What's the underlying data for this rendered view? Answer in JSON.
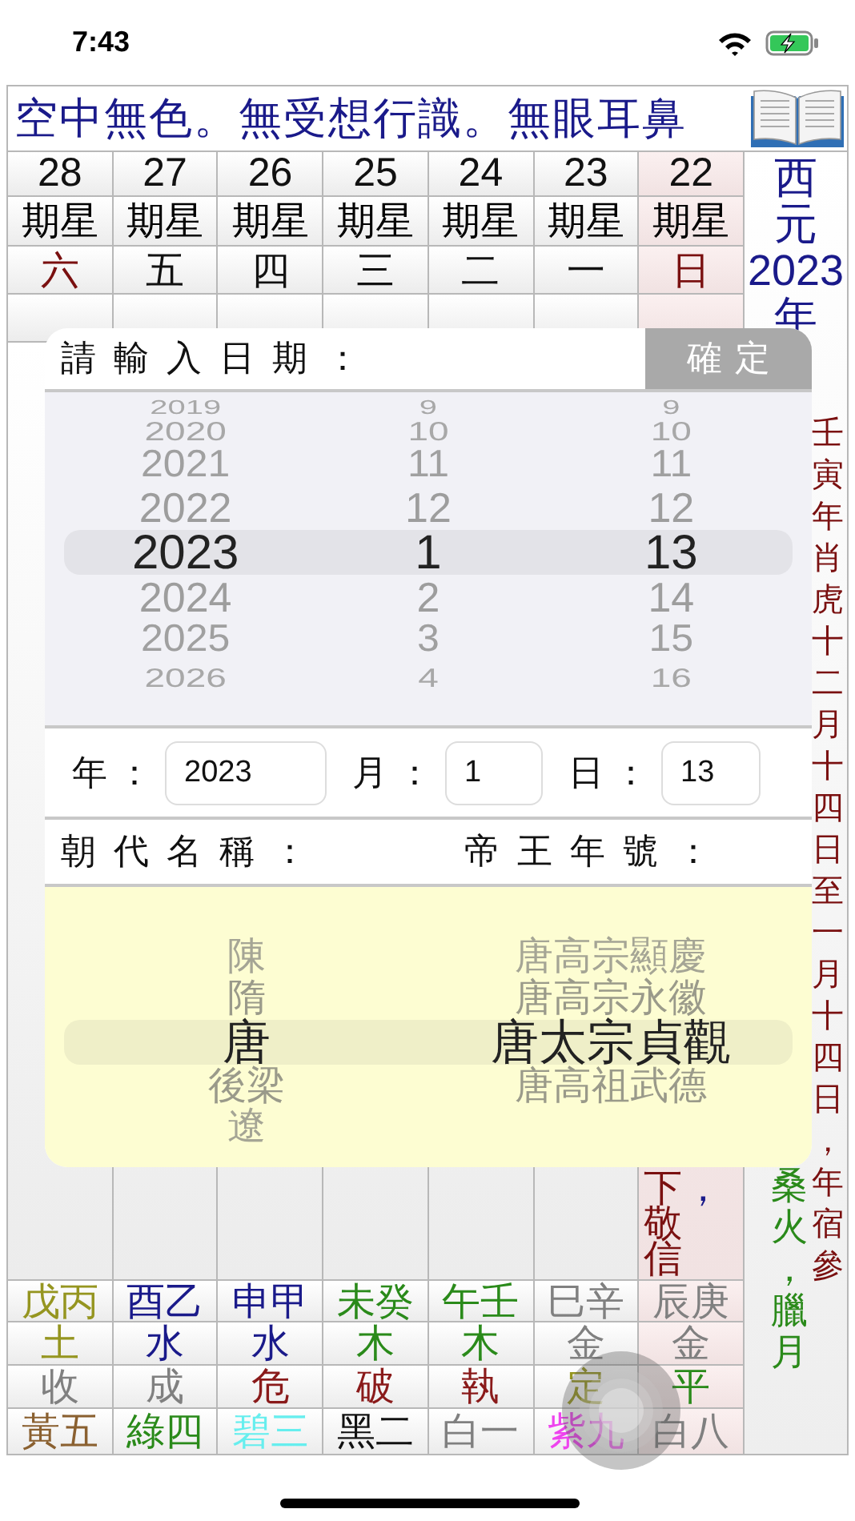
{
  "status_bar": {
    "time": "7:43"
  },
  "banner": {
    "text": "空中無色。無受想行識。無眼耳鼻"
  },
  "days": [
    {
      "date": "28",
      "week_label": "期星",
      "weekday": {
        "text": "六",
        "color": "#7a1010"
      },
      "ganzhi": {
        "text": "戊丙",
        "color": "#959520"
      },
      "element": {
        "text": "土",
        "color": "#959520"
      },
      "officer": {
        "text": "收",
        "color": "#808080"
      },
      "star": {
        "text": "黃五",
        "color": "#8a6030"
      },
      "selected": false
    },
    {
      "date": "27",
      "week_label": "期星",
      "weekday": {
        "text": "五",
        "color": "#111111"
      },
      "ganzhi": {
        "text": "酉乙",
        "color": "#1a1a8a"
      },
      "element": {
        "text": "水",
        "color": "#1a1a8a"
      },
      "officer": {
        "text": "成",
        "color": "#808080"
      },
      "star": {
        "text": "綠四",
        "color": "#2a8a1a"
      },
      "selected": false
    },
    {
      "date": "26",
      "week_label": "期星",
      "weekday": {
        "text": "四",
        "color": "#111111"
      },
      "ganzhi": {
        "text": "申甲",
        "color": "#1a1a8a"
      },
      "element": {
        "text": "水",
        "color": "#1a1a8a"
      },
      "officer": {
        "text": "危",
        "color": "#8a1a1a"
      },
      "star": {
        "text": "碧三",
        "color": "#66eeee"
      },
      "selected": false
    },
    {
      "date": "25",
      "week_label": "期星",
      "weekday": {
        "text": "三",
        "color": "#111111"
      },
      "ganzhi": {
        "text": "未癸",
        "color": "#2a8a1a"
      },
      "element": {
        "text": "木",
        "color": "#2a8a1a"
      },
      "officer": {
        "text": "破",
        "color": "#8a1a1a"
      },
      "star": {
        "text": "黑二",
        "color": "#111111"
      },
      "selected": false
    },
    {
      "date": "24",
      "week_label": "期星",
      "weekday": {
        "text": "二",
        "color": "#111111"
      },
      "ganzhi": {
        "text": "午壬",
        "color": "#2a8a1a"
      },
      "element": {
        "text": "木",
        "color": "#2a8a1a"
      },
      "officer": {
        "text": "執",
        "color": "#8a1a1a"
      },
      "star": {
        "text": "白一",
        "color": "#808080"
      },
      "selected": false
    },
    {
      "date": "23",
      "week_label": "期星",
      "weekday": {
        "text": "一",
        "color": "#111111"
      },
      "ganzhi": {
        "text": "巳辛",
        "color": "#808080"
      },
      "element": {
        "text": "金",
        "color": "#808080"
      },
      "officer": {
        "text": "定",
        "color": "#959520"
      },
      "star": {
        "text": "紫九",
        "color": "#ee44ee"
      },
      "selected": false
    },
    {
      "date": "22",
      "week_label": "期星",
      "weekday": {
        "text": "日",
        "color": "#7a1010"
      },
      "notes": [
        {
          "text": "下敬信",
          "color": "#7a1010"
        },
        {
          "text": "，",
          "color": "#1a1a8a"
        }
      ],
      "ganzhi": {
        "text": "辰庚",
        "color": "#808080"
      },
      "element": {
        "text": "金",
        "color": "#808080"
      },
      "officer": {
        "text": "平",
        "color": "#2a8a1a"
      },
      "star": {
        "text": "白八",
        "color": "#808080"
      },
      "selected": true
    }
  ],
  "side": {
    "year": "西元2023年",
    "lunar_range": "壬寅年肖虎十二月十四日至一月十四日，年宿參",
    "month_info": "桑火，臘月"
  },
  "dialog": {
    "title": "請輸入日期：",
    "confirm_button": "確定",
    "date_wheel": {
      "columns": [
        {
          "items": [
            {
              "label": "2019",
              "selected": false
            },
            {
              "label": "2020",
              "selected": false
            },
            {
              "label": "2021",
              "selected": false
            },
            {
              "label": "2022",
              "selected": false
            },
            {
              "label": "2023",
              "selected": true
            },
            {
              "label": "2024",
              "selected": false
            },
            {
              "label": "2025",
              "selected": false
            },
            {
              "label": "2026",
              "selected": false
            }
          ]
        },
        {
          "items": [
            {
              "label": "9",
              "selected": false
            },
            {
              "label": "10",
              "selected": false
            },
            {
              "label": "11",
              "selected": false
            },
            {
              "label": "12",
              "selected": false
            },
            {
              "label": "1",
              "selected": true
            },
            {
              "label": "2",
              "selected": false
            },
            {
              "label": "3",
              "selected": false
            },
            {
              "label": "4",
              "selected": false
            }
          ]
        },
        {
          "items": [
            {
              "label": "9",
              "selected": false
            },
            {
              "label": "10",
              "selected": false
            },
            {
              "label": "11",
              "selected": false
            },
            {
              "label": "12",
              "selected": false
            },
            {
              "label": "13",
              "selected": true
            },
            {
              "label": "14",
              "selected": false
            },
            {
              "label": "15",
              "selected": false
            },
            {
              "label": "16",
              "selected": false
            }
          ]
        }
      ]
    },
    "fields": [
      {
        "label": "年：",
        "value": "2023"
      },
      {
        "label": "月：",
        "value": "1"
      },
      {
        "label": "日：",
        "value": "13"
      }
    ],
    "dynasty_label": "朝代名稱：",
    "reign_label": "帝王年號：",
    "era_wheel": {
      "columns": [
        {
          "items": [
            {
              "label": "陳",
              "selected": false
            },
            {
              "label": "隋",
              "selected": false
            },
            {
              "label": "唐",
              "selected": true
            },
            {
              "label": "後梁",
              "selected": false
            },
            {
              "label": "遼",
              "selected": false
            }
          ]
        },
        {
          "items": [
            {
              "label": "唐高宗顯慶",
              "selected": false
            },
            {
              "label": "唐高宗永徽",
              "selected": false
            },
            {
              "label": "唐太宗貞觀",
              "selected": true
            },
            {
              "label": "唐高祖武德",
              "selected": false
            }
          ]
        }
      ]
    }
  }
}
